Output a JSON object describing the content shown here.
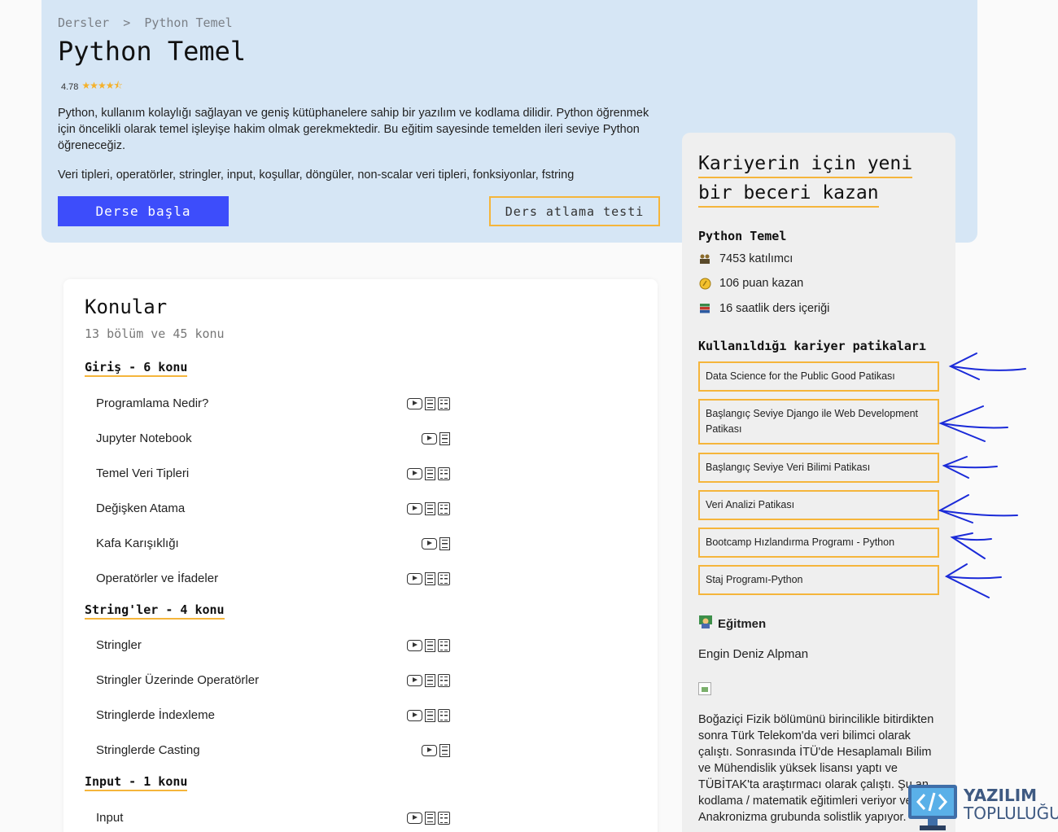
{
  "hero": {
    "breadcrumb": [
      "Dersler",
      ">",
      "Python Temel"
    ],
    "title": "Python Temel",
    "rating": "4.78",
    "rating_stars": 4.5,
    "description": "Python, kullanım kolaylığı sağlayan ve geniş kütüphanelere sahip bir yazılım ve kodlama dilidir. Python öğrenmek için öncelikli olarak temel işleyişe hakim olmak gerekmektedir. Bu eğitim sayesinde temelden ileri seviye Python öğreneceğiz.",
    "topics": "Veri tipleri, operatörler, stringler, input, koşullar, döngüler, non-scalar veri tipleri, fonksiyonlar, fstring",
    "start_button": "Derse başla",
    "skip_button": "Ders atlama testi"
  },
  "sidebar": {
    "heading_line1": "Kariyerin için yeni",
    "heading_line2": "bir beceri kazan",
    "course_name": "Python Temel",
    "stats": [
      {
        "icon": "participants-icon",
        "text": "7453 katılımcı"
      },
      {
        "icon": "coin-icon",
        "text": "106 puan kazan"
      },
      {
        "icon": "books-icon",
        "text": "16 saatlik ders içeriği"
      }
    ],
    "paths_heading": "Kullanıldığı kariyer patikaları",
    "paths": [
      "Data Science for the Public Good Patikası",
      "Başlangıç Seviye Django ile Web Development Patikası",
      "Başlangıç Seviye Veri Bilimi Patikası",
      "Veri Analizi Patikası",
      "Bootcamp Hızlandırma Programı - Python",
      "Staj Programı-Python"
    ],
    "instructor_heading": "Eğitmen",
    "instructor_name": "Engin Deniz Alpman",
    "bio": "Boğaziçi Fizik bölümünü birincilikle bitirdikten sonra Türk Telekom'da veri bilimci olarak çalıştı. Sonrasında İTÜ'de Hesaplamalı Bilim ve Mühendislik yüksek lisansı yaptı ve TÜBİTAK'ta araştırmacı olarak çalıştı. Şu an kodlama / matematik eğitimleri veriyor ve Anakronizma grubunda solistlik yapıyor."
  },
  "topics_card": {
    "title": "Konular",
    "subtitle": "13 bölüm ve 45 konu",
    "sections": [
      {
        "title": "Giriş - 6 konu",
        "lessons": [
          {
            "name": "Programlama Nedir?",
            "icons": [
              "video",
              "doc",
              "quiz"
            ]
          },
          {
            "name": "Jupyter Notebook",
            "icons": [
              "video",
              "doc"
            ]
          },
          {
            "name": "Temel Veri Tipleri",
            "icons": [
              "video",
              "doc",
              "quiz"
            ]
          },
          {
            "name": "Değişken Atama",
            "icons": [
              "video",
              "doc",
              "quiz"
            ]
          },
          {
            "name": "Kafa Karışıklığı",
            "icons": [
              "video",
              "doc"
            ]
          },
          {
            "name": "Operatörler ve İfadeler",
            "icons": [
              "video",
              "doc",
              "quiz"
            ]
          }
        ]
      },
      {
        "title": "String'ler - 4 konu",
        "lessons": [
          {
            "name": "Stringler",
            "icons": [
              "video",
              "doc",
              "quiz"
            ]
          },
          {
            "name": "Stringler Üzerinde Operatörler",
            "icons": [
              "video",
              "doc",
              "quiz"
            ]
          },
          {
            "name": "Stringlerde İndexleme",
            "icons": [
              "video",
              "doc",
              "quiz"
            ]
          },
          {
            "name": "Stringlerde Casting",
            "icons": [
              "video",
              "doc"
            ]
          }
        ]
      },
      {
        "title": "Input - 1 konu",
        "lessons": [
          {
            "name": "Input",
            "icons": [
              "video",
              "doc",
              "quiz"
            ]
          }
        ]
      }
    ]
  },
  "watermark": {
    "line1": "YAZILIM",
    "line2": "TOPLULUĞU"
  },
  "colors": {
    "accent": "#3d4dfb",
    "highlight": "#f5b53b",
    "hero_bg": "#d6e6f5",
    "annotation": "#1a2ad8"
  }
}
